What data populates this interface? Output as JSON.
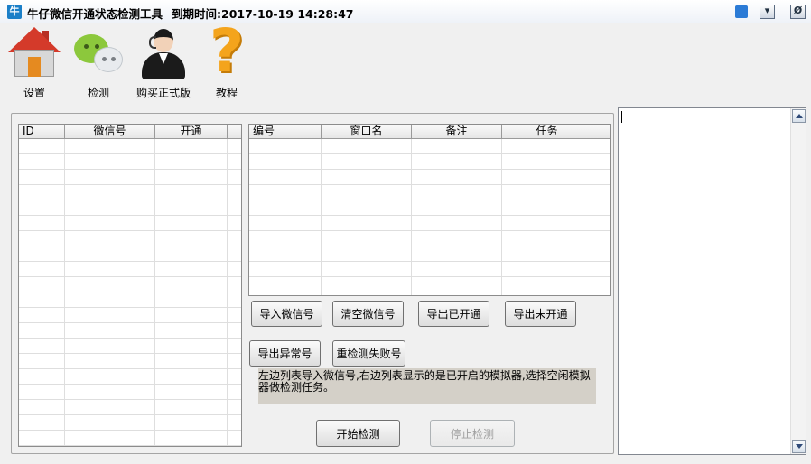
{
  "window": {
    "title": "牛仔微信开通状态检测工具",
    "expiry": "到期时间:2017-10-19 14:28:47",
    "app_icon_text": "牛",
    "controls": {
      "minimize": "▾",
      "close": "Ø"
    }
  },
  "toolbar": [
    {
      "label": "设置",
      "icon": "house-icon"
    },
    {
      "label": "检测",
      "icon": "wechat-icon"
    },
    {
      "label": "购买正式版",
      "icon": "customer-service-icon"
    },
    {
      "label": "教程",
      "icon": "question-icon"
    }
  ],
  "left_table": {
    "columns": [
      "ID",
      "微信号",
      "开通"
    ],
    "rows": []
  },
  "right_table": {
    "columns": [
      "编号",
      "窗口名",
      "备注",
      "任务"
    ],
    "rows": []
  },
  "buttons": {
    "import": "导入微信号",
    "clear": "清空微信号",
    "export_opened": "导出已开通",
    "export_unopened": "导出未开通",
    "export_abnormal": "导出异常号",
    "recheck_failed": "重检测失败号",
    "start": "开始检测",
    "stop": "停止检测"
  },
  "hint_text": "左边列表导入微信号,右边列表显示的是已开启的模拟器,选择空闲模拟器做检测任务。",
  "log_text": "",
  "colors": {
    "hint_background": "#d4d0c8",
    "window_background": "#f0f0f0"
  }
}
